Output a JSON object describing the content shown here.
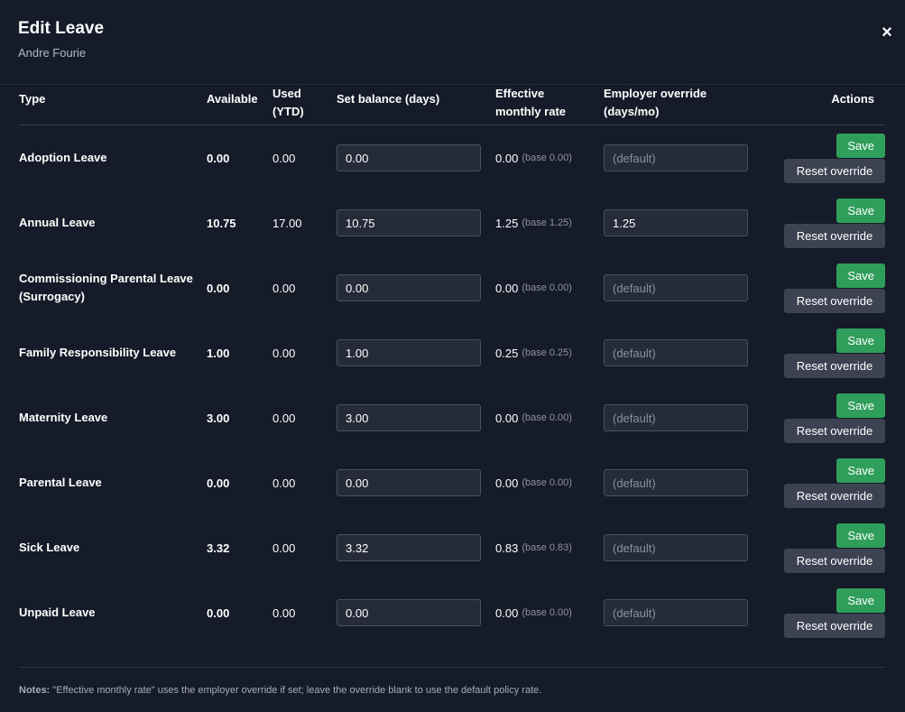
{
  "modal": {
    "title": "Edit Leave",
    "subtitle": "Andre Fourie",
    "close_label": "×"
  },
  "table": {
    "headers": {
      "type": "Type",
      "available": "Available",
      "used_line1": "Used",
      "used_line2": "(YTD)",
      "set_balance": "Set balance (days)",
      "rate_line1": "Effective",
      "rate_line2": "monthly rate",
      "override_line1": "Employer override",
      "override_line2": "(days/mo)",
      "actions": "Actions"
    },
    "rows": [
      {
        "type": "Adoption Leave",
        "available": "0.00",
        "used": "0.00",
        "balance": "0.00",
        "rate": "0.00",
        "base": "(base 0.00)",
        "override": "",
        "override_placeholder": "(default)",
        "save": "Save",
        "reset": "Reset override"
      },
      {
        "type": "Annual Leave",
        "available": "10.75",
        "used": "17.00",
        "balance": "10.75",
        "rate": "1.25",
        "base": "(base 1.25)",
        "override": "1.25",
        "override_placeholder": "(default)",
        "save": "Save",
        "reset": "Reset override"
      },
      {
        "type_line1": "Commissioning Parental Leave",
        "type_line2": "(Surrogacy)",
        "available": "0.00",
        "used": "0.00",
        "balance": "0.00",
        "rate": "0.00",
        "base": "(base 0.00)",
        "override": "",
        "override_placeholder": "(default)",
        "save": "Save",
        "reset": "Reset override"
      },
      {
        "type": "Family Responsibility Leave",
        "available": "1.00",
        "used": "0.00",
        "balance": "1.00",
        "rate": "0.25",
        "base": "(base 0.25)",
        "override": "",
        "override_placeholder": "(default)",
        "save": "Save",
        "reset": "Reset override"
      },
      {
        "type": "Maternity Leave",
        "available": "3.00",
        "used": "0.00",
        "balance": "3.00",
        "rate": "0.00",
        "base": "(base 0.00)",
        "override": "",
        "override_placeholder": "(default)",
        "save": "Save",
        "reset": "Reset override"
      },
      {
        "type": "Parental Leave",
        "available": "0.00",
        "used": "0.00",
        "balance": "0.00",
        "rate": "0.00",
        "base": "(base 0.00)",
        "override": "",
        "override_placeholder": "(default)",
        "save": "Save",
        "reset": "Reset override"
      },
      {
        "type": "Sick Leave",
        "available": "3.32",
        "used": "0.00",
        "balance": "3.32",
        "rate": "0.83",
        "base": "(base 0.83)",
        "override": "",
        "override_placeholder": "(default)",
        "save": "Save",
        "reset": "Reset override"
      },
      {
        "type": "Unpaid Leave",
        "available": "0.00",
        "used": "0.00",
        "balance": "0.00",
        "rate": "0.00",
        "base": "(base 0.00)",
        "override": "",
        "override_placeholder": "(default)",
        "save": "Save",
        "reset": "Reset override"
      }
    ]
  },
  "notes": {
    "label": "Notes:",
    "text": " \"Effective monthly rate\" uses the employer override if set; leave the override blank to use the default policy rate."
  },
  "colors": {
    "background": "#151b28",
    "save_button": "#2f9e5a",
    "reset_button": "#3c4252",
    "input_bg": "#252b38"
  }
}
